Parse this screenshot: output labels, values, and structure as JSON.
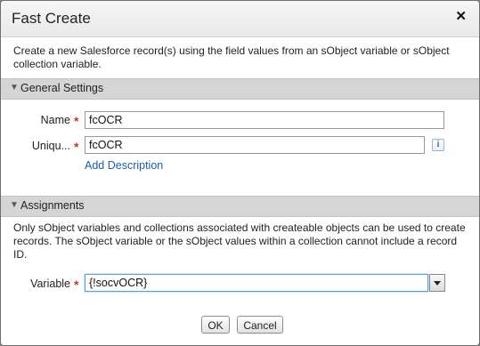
{
  "dialog": {
    "title": "Fast Create",
    "close_icon": "close-icon",
    "description": "Create a new Salesforce record(s) using the field values from an sObject variable or sObject collection variable."
  },
  "general_settings": {
    "header": "General Settings",
    "name_label": "Name",
    "name_value": "fcOCR",
    "unique_label": "Uniqu...",
    "unique_value": "fcOCR",
    "info_icon_text": "i",
    "add_description": "Add Description"
  },
  "assignments": {
    "header": "Assignments",
    "help_text": "Only sObject variables and collections associated with createable objects can be used to create records. The sObject variable or the sObject values within a collection cannot include a record ID.",
    "variable_label": "Variable",
    "variable_value": "{!socvOCR}"
  },
  "required_marker": "*",
  "buttons": {
    "ok": "OK",
    "cancel": "Cancel"
  },
  "colors": {
    "section_header_bg": "#d5d5d5",
    "required": "#c23934",
    "link": "#1a5fa8"
  }
}
